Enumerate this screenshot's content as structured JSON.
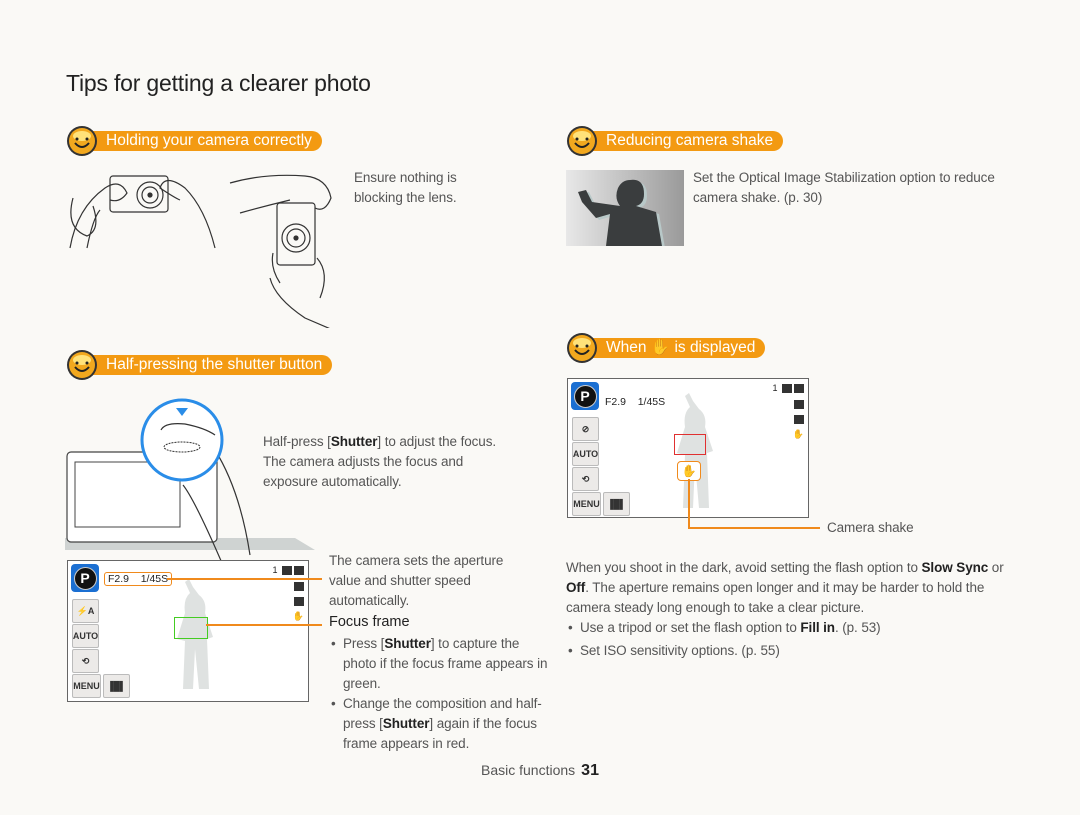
{
  "page": {
    "title": "Tips for getting a clearer photo",
    "footer_section": "Basic functions",
    "footer_page": "31"
  },
  "colors": {
    "accent": "#f39a12",
    "focus_green": "#44cc22",
    "focus_red": "#e03030",
    "callout_orange": "#f08a1c",
    "shutter_circle_blue": "#2a8de8",
    "background": "#faf9f6"
  },
  "sections": {
    "holding": {
      "heading": "Holding your camera correctly",
      "icon": "smiley-sun-icon",
      "text": "Ensure nothing is blocking the lens."
    },
    "half_press": {
      "heading": "Half-pressing the shutter button",
      "icon": "smiley-sun-icon",
      "text_pre": "Half-press [",
      "text_bold": "Shutter",
      "text_post": "] to adjust the focus. The camera adjusts the focus and exposure automatically.",
      "callout_aperture": "The camera sets the aperture value and shutter speed automatically.",
      "focus_frame_heading": "Focus frame",
      "bullets": [
        {
          "pre": "Press [",
          "bold": "Shutter",
          "post": "] to capture the photo if the focus frame appears in green."
        },
        {
          "pre": "Change the composition and half-press [",
          "bold": "Shutter",
          "post": "] again if the focus frame appears in red."
        }
      ]
    },
    "reducing": {
      "heading": "Reducing camera shake",
      "icon": "smiley-sun-icon",
      "text": "Set the Optical Image Stabilization option to reduce camera shake. (p. 30)"
    },
    "when_displayed": {
      "heading_pre": "When",
      "heading_icon": "camera-shake-hand-icon",
      "heading_post": "is displayed",
      "callout_label": "Camera shake",
      "para_pre": "When you shoot in the dark, avoid setting the flash option to ",
      "para_bold1": "Slow Sync",
      "para_mid": " or ",
      "para_bold2": "Off",
      "para_post": ". The aperture remains open longer and it may be harder to hold the camera steady long enough to take a clear picture.",
      "bullets": [
        {
          "pre": "Use a tripod or set the flash option to ",
          "bold": "Fill in",
          "post": ". (p. 53)"
        },
        {
          "pre": "Set ISO sensitivity options. (p. 55)",
          "bold": "",
          "post": ""
        }
      ]
    }
  },
  "lcd": {
    "mode": "P",
    "aperture": "F2.9",
    "shutter": "1/45S",
    "shots": "1",
    "menu_label": "MENU",
    "left_buttons_half": [
      "flash-auto-icon",
      "auto-focus-icon",
      "timer-off-icon"
    ],
    "left_buttons_shake": [
      "flash-off-icon",
      "auto-focus-icon",
      "timer-off-icon"
    ],
    "right_icons": [
      "image-size-icon",
      "metering-icon",
      "ois-icon"
    ]
  }
}
